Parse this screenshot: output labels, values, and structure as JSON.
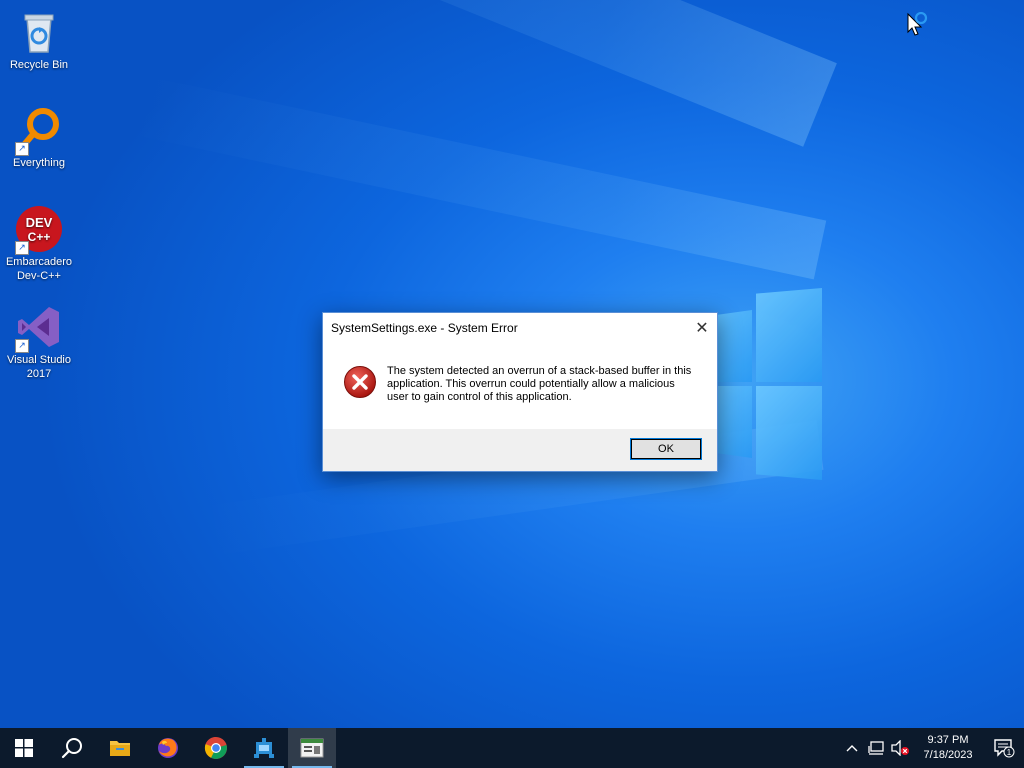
{
  "desktop": {
    "icons": [
      {
        "label": "Recycle Bin",
        "icon": "recycle-bin-icon"
      },
      {
        "label": "Everything",
        "icon": "everything-search-icon"
      },
      {
        "label": "Embarcadero\nDev-C++",
        "icon": "dev-cpp-icon"
      },
      {
        "label": "Visual Studio\n2017",
        "icon": "visual-studio-icon"
      }
    ],
    "devcpp_logo_text_1": "DEV",
    "devcpp_logo_text_2": "C++"
  },
  "dialog": {
    "title": "SystemSettings.exe - System Error",
    "close_glyph": "✕",
    "message": "The system detected an overrun of a stack-based buffer in this application. This overrun could potentially allow a malicious user to gain control of this application.",
    "icon": "error-icon",
    "ok_label": "OK"
  },
  "taskbar": {
    "apps": [
      {
        "icon": "windows-start-icon"
      },
      {
        "icon": "search-icon"
      },
      {
        "icon": "file-explorer-icon"
      },
      {
        "icon": "firefox-icon"
      },
      {
        "icon": "chrome-icon"
      },
      {
        "icon": "network-app-icon"
      },
      {
        "icon": "system-settings-window-icon"
      }
    ],
    "tray": {
      "chevron": "^",
      "time": "9:37 PM",
      "date": "7/18/2023",
      "notification_count": "1"
    }
  },
  "colors": {
    "taskbar_bg": "#0c1a2c",
    "accent": "#0078d7",
    "error_red": "#c42b1c"
  }
}
